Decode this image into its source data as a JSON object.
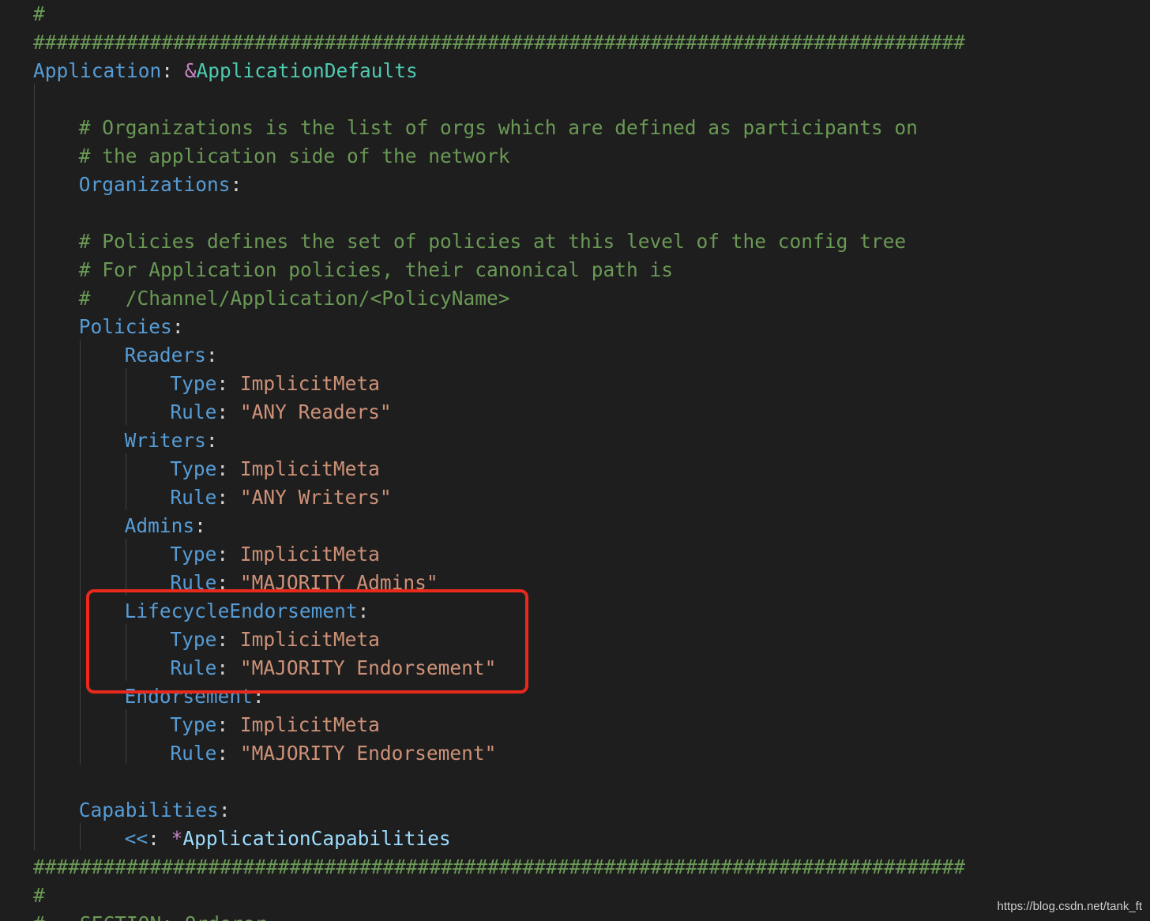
{
  "editor": {
    "lines": [
      {
        "indent": 0,
        "parts": [
          {
            "t": "comment",
            "v": "#"
          }
        ]
      },
      {
        "indent": 0,
        "parts": [
          {
            "t": "comment",
            "v": "################################################################################"
          }
        ]
      },
      {
        "indent": 0,
        "parts": [
          {
            "t": "key",
            "v": "Application"
          },
          {
            "t": "punc",
            "v": ": "
          },
          {
            "t": "anchor-sym",
            "v": "&"
          },
          {
            "t": "anchor",
            "v": "ApplicationDefaults"
          }
        ]
      },
      {
        "indent": 0,
        "parts": []
      },
      {
        "indent": 4,
        "parts": [
          {
            "t": "comment",
            "v": "# Organizations is the list of orgs which are defined as participants on"
          }
        ]
      },
      {
        "indent": 4,
        "parts": [
          {
            "t": "comment",
            "v": "# the application side of the network"
          }
        ]
      },
      {
        "indent": 4,
        "parts": [
          {
            "t": "key",
            "v": "Organizations"
          },
          {
            "t": "punc",
            "v": ":"
          }
        ]
      },
      {
        "indent": 0,
        "parts": []
      },
      {
        "indent": 4,
        "parts": [
          {
            "t": "comment",
            "v": "# Policies defines the set of policies at this level of the config tree"
          }
        ]
      },
      {
        "indent": 4,
        "parts": [
          {
            "t": "comment",
            "v": "# For Application policies, their canonical path is"
          }
        ]
      },
      {
        "indent": 4,
        "parts": [
          {
            "t": "comment",
            "v": "#   /Channel/Application/<PolicyName>"
          }
        ]
      },
      {
        "indent": 4,
        "parts": [
          {
            "t": "key",
            "v": "Policies"
          },
          {
            "t": "punc",
            "v": ":"
          }
        ]
      },
      {
        "indent": 8,
        "parts": [
          {
            "t": "key",
            "v": "Readers"
          },
          {
            "t": "punc",
            "v": ":"
          }
        ]
      },
      {
        "indent": 12,
        "parts": [
          {
            "t": "key",
            "v": "Type"
          },
          {
            "t": "punc",
            "v": ": "
          },
          {
            "t": "val",
            "v": "ImplicitMeta"
          }
        ]
      },
      {
        "indent": 12,
        "parts": [
          {
            "t": "key",
            "v": "Rule"
          },
          {
            "t": "punc",
            "v": ": "
          },
          {
            "t": "val",
            "v": "\"ANY Readers\""
          }
        ]
      },
      {
        "indent": 8,
        "parts": [
          {
            "t": "key",
            "v": "Writers"
          },
          {
            "t": "punc",
            "v": ":"
          }
        ]
      },
      {
        "indent": 12,
        "parts": [
          {
            "t": "key",
            "v": "Type"
          },
          {
            "t": "punc",
            "v": ": "
          },
          {
            "t": "val",
            "v": "ImplicitMeta"
          }
        ]
      },
      {
        "indent": 12,
        "parts": [
          {
            "t": "key",
            "v": "Rule"
          },
          {
            "t": "punc",
            "v": ": "
          },
          {
            "t": "val",
            "v": "\"ANY Writers\""
          }
        ]
      },
      {
        "indent": 8,
        "parts": [
          {
            "t": "key",
            "v": "Admins"
          },
          {
            "t": "punc",
            "v": ":"
          }
        ]
      },
      {
        "indent": 12,
        "parts": [
          {
            "t": "key",
            "v": "Type"
          },
          {
            "t": "punc",
            "v": ": "
          },
          {
            "t": "val",
            "v": "ImplicitMeta"
          }
        ]
      },
      {
        "indent": 12,
        "parts": [
          {
            "t": "key",
            "v": "Rule"
          },
          {
            "t": "punc",
            "v": ": "
          },
          {
            "t": "val",
            "v": "\"MAJORITY Admins\""
          }
        ]
      },
      {
        "indent": 8,
        "parts": [
          {
            "t": "key",
            "v": "LifecycleEndorsement"
          },
          {
            "t": "punc",
            "v": ":"
          }
        ]
      },
      {
        "indent": 12,
        "parts": [
          {
            "t": "key",
            "v": "Type"
          },
          {
            "t": "punc",
            "v": ": "
          },
          {
            "t": "val",
            "v": "ImplicitMeta"
          }
        ]
      },
      {
        "indent": 12,
        "parts": [
          {
            "t": "key",
            "v": "Rule"
          },
          {
            "t": "punc",
            "v": ": "
          },
          {
            "t": "val",
            "v": "\"MAJORITY Endorsement\""
          }
        ]
      },
      {
        "indent": 8,
        "parts": [
          {
            "t": "key",
            "v": "Endorsement"
          },
          {
            "t": "punc",
            "v": ":"
          }
        ]
      },
      {
        "indent": 12,
        "parts": [
          {
            "t": "key",
            "v": "Type"
          },
          {
            "t": "punc",
            "v": ": "
          },
          {
            "t": "val",
            "v": "ImplicitMeta"
          }
        ]
      },
      {
        "indent": 12,
        "parts": [
          {
            "t": "key",
            "v": "Rule"
          },
          {
            "t": "punc",
            "v": ": "
          },
          {
            "t": "val",
            "v": "\"MAJORITY Endorsement\""
          }
        ]
      },
      {
        "indent": 0,
        "parts": []
      },
      {
        "indent": 4,
        "parts": [
          {
            "t": "key",
            "v": "Capabilities"
          },
          {
            "t": "punc",
            "v": ":"
          }
        ]
      },
      {
        "indent": 8,
        "parts": [
          {
            "t": "key",
            "v": "<<"
          },
          {
            "t": "punc",
            "v": ": "
          },
          {
            "t": "anchor-sym",
            "v": "*"
          },
          {
            "t": "alias",
            "v": "ApplicationCapabilities"
          }
        ]
      },
      {
        "indent": 0,
        "parts": [
          {
            "t": "comment",
            "v": "################################################################################"
          }
        ]
      },
      {
        "indent": 0,
        "parts": [
          {
            "t": "comment",
            "v": "#"
          }
        ]
      },
      {
        "indent": 0,
        "parts": [
          {
            "t": "comment",
            "v": "#   SECTION: Orderer"
          }
        ]
      }
    ]
  },
  "watermark": "https://blog.csdn.net/tank_ft"
}
